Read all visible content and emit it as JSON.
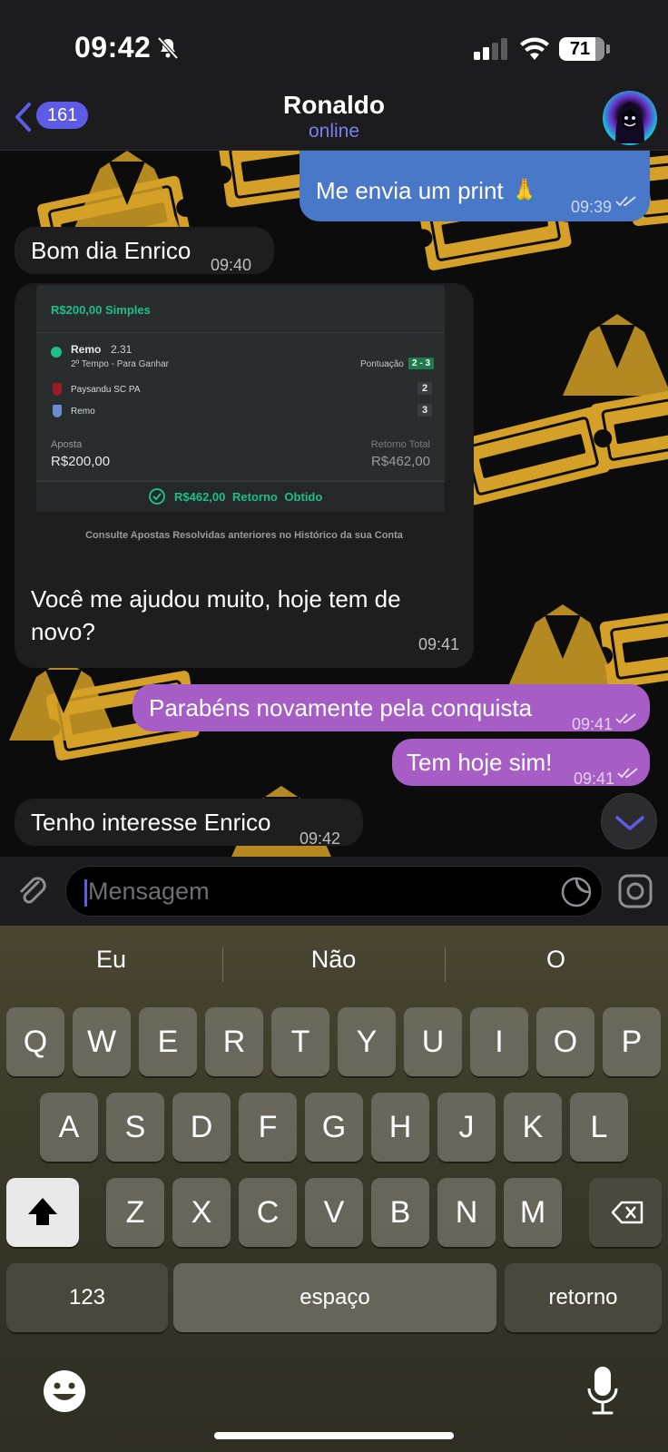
{
  "status_bar": {
    "time": "09:42",
    "battery": "71"
  },
  "header": {
    "back_count": "161",
    "name": "Ronaldo",
    "status": "online"
  },
  "messages": [
    {
      "direction": "out",
      "text": "Me envia um print 🙏",
      "time": "09:39"
    },
    {
      "direction": "in",
      "text": "Bom dia Enrico",
      "time": "09:40"
    },
    {
      "direction": "in",
      "text": "Você me ajudou muito, hoje tem de novo?",
      "time": "09:41"
    },
    {
      "direction": "out",
      "text": "Parabéns novamente pela conquista",
      "time": "09:41"
    },
    {
      "direction": "out",
      "text": "Tem hoje sim!",
      "time": "09:41"
    },
    {
      "direction": "in",
      "text": "Tenho interesse Enrico",
      "time": "09:42"
    }
  ],
  "bet_slip": {
    "title": "R$200,00 Simples",
    "selection": "Remo",
    "odd": "2.31",
    "market": "2º Tempo - Para Ganhar",
    "score_label": "Pontuação",
    "score": "2 - 3",
    "team1": "Paysandu SC PA",
    "team1_goals": "2",
    "team2": "Remo",
    "team2_goals": "3",
    "stake_label": "Aposta",
    "stake": "R$200,00",
    "return_label": "Retorno Total",
    "return": "R$462,00",
    "result": "R$462,00  Retorno Obtido",
    "note": "Consulte Apostas Resolvidas anteriores no Histórico da sua Conta"
  },
  "input": {
    "placeholder": "Mensagem"
  },
  "keyboard": {
    "suggestions": [
      "Eu",
      "Não",
      "O"
    ],
    "row1": [
      "Q",
      "W",
      "E",
      "R",
      "T",
      "Y",
      "U",
      "I",
      "O",
      "P"
    ],
    "row2": [
      "A",
      "S",
      "D",
      "F",
      "G",
      "H",
      "J",
      "K",
      "L"
    ],
    "row3": [
      "Z",
      "X",
      "C",
      "V",
      "B",
      "N",
      "M"
    ],
    "numbers_key": "123",
    "space_key": "espaço",
    "return_key": "retorno"
  },
  "colors": {
    "accent": "#5e5ce6",
    "outgoing_blue": "#4a78c8",
    "outgoing_purple": "#a65ec6",
    "incoming": "#1e1e1e",
    "bet_green": "#1fbf8a"
  }
}
